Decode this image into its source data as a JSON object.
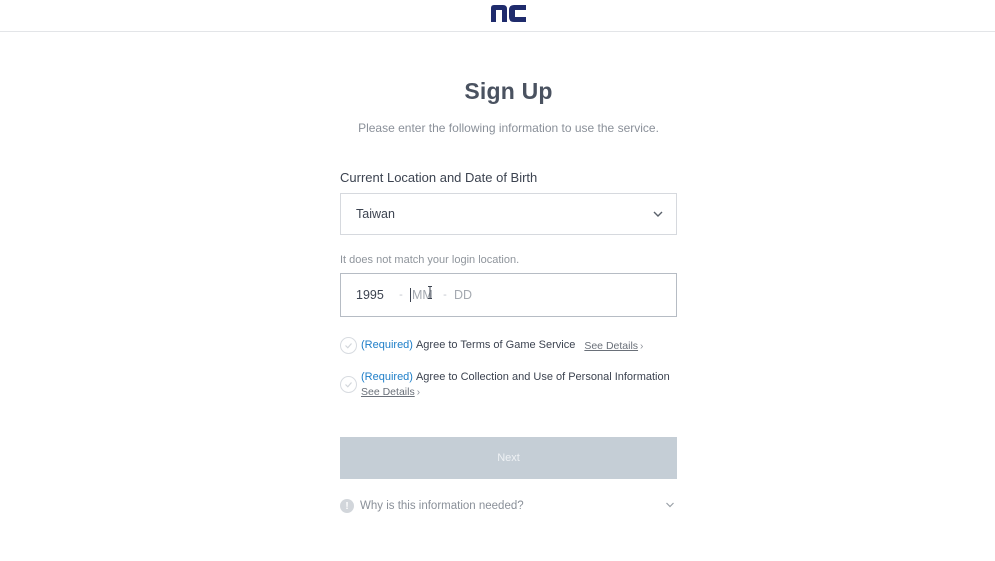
{
  "header": {
    "logo_text": "nc",
    "brand_color": "#1f2b6c"
  },
  "page": {
    "title": "Sign Up",
    "subtitle": "Please enter the following information to use the service."
  },
  "form": {
    "section_label": "Current Location and Date of Birth",
    "location": {
      "value": "Taiwan",
      "icon": "chevron-down-icon"
    },
    "location_hint": "It does not match your login location.",
    "birth": {
      "year": "1995",
      "month_placeholder": "MM",
      "day_placeholder": "DD",
      "separator": "-"
    },
    "agreements": [
      {
        "required_label": "(Required)",
        "text": "Agree to Terms of Game Service",
        "details_label": "See Details",
        "checked": false
      },
      {
        "required_label": "(Required)",
        "text": "Agree to Collection and Use of Personal Information",
        "details_label": "See Details",
        "checked": false
      }
    ],
    "next_label": "Next",
    "next_enabled": false,
    "why_label": "Why is this information needed?",
    "accent_color": "#1e7ec8"
  }
}
